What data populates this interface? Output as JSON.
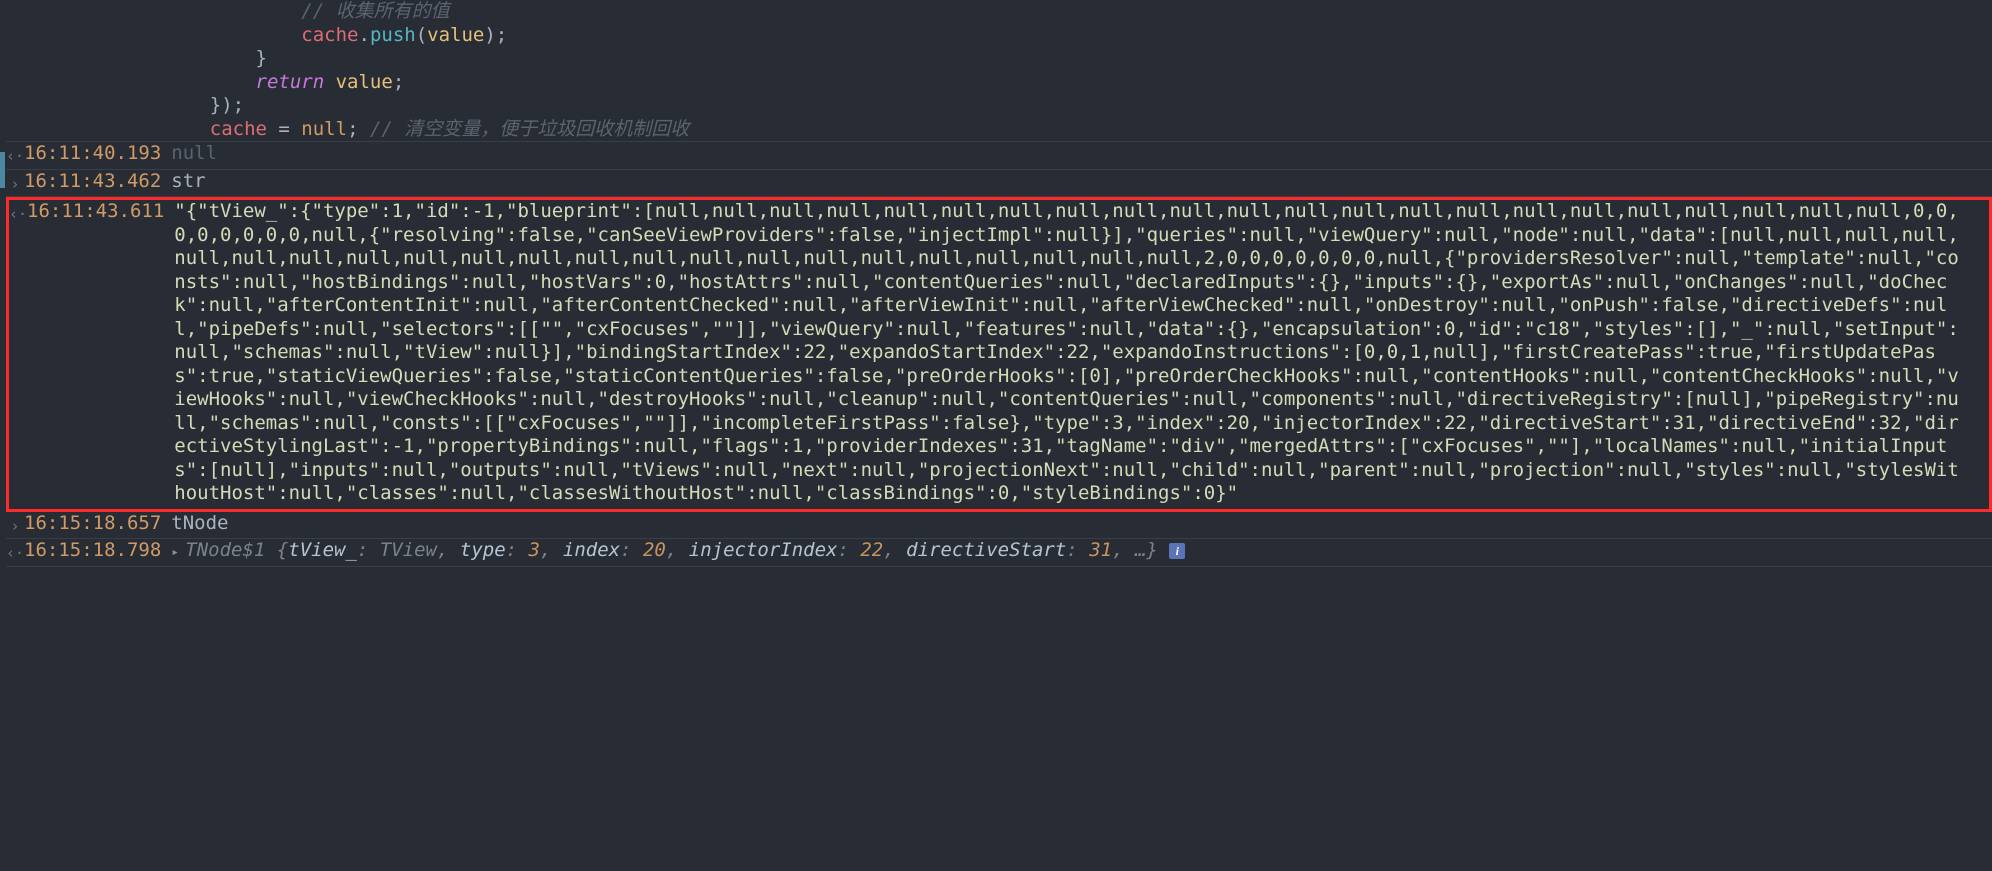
{
  "code": {
    "comment_collect": "// 收集所有的值",
    "push_line": {
      "obj": "cache",
      "fn": "push",
      "arg": "value"
    },
    "return_line": {
      "kw": "return",
      "val": "value"
    },
    "assign_line": {
      "obj": "cache",
      "val": "null",
      "comment": "// 清空变量，便于垃圾回收机制回收"
    }
  },
  "rows": [
    {
      "icon": "‹·",
      "ts": "16:11:40.193",
      "kind": "undef",
      "text": "null"
    },
    {
      "icon": "›",
      "ts": "16:11:43.462",
      "kind": "input",
      "text": "str"
    },
    {
      "icon": "‹·",
      "ts": "16:11:43.611",
      "kind": "bigstr",
      "red": true,
      "text": "\"{\"tView_\":{\"type\":1,\"id\":-1,\"blueprint\":[null,null,null,null,null,null,null,null,null,null,null,null,null,null,null,null,null,null,null,null,null,null,0,0,0,0,0,0,0,0,null,{\"resolving\":false,\"canSeeViewProviders\":false,\"injectImpl\":null}],\"queries\":null,\"viewQuery\":null,\"node\":null,\"data\":[null,null,null,null,null,null,null,null,null,null,null,null,null,null,null,null,null,null,null,null,null,null,2,0,0,0,0,0,0,0,null,{\"providersResolver\":null,\"template\":null,\"consts\":null,\"hostBindings\":null,\"hostVars\":0,\"hostAttrs\":null,\"contentQueries\":null,\"declaredInputs\":{},\"inputs\":{},\"exportAs\":null,\"onChanges\":null,\"doCheck\":null,\"afterContentInit\":null,\"afterContentChecked\":null,\"afterViewInit\":null,\"afterViewChecked\":null,\"onDestroy\":null,\"onPush\":false,\"directiveDefs\":null,\"pipeDefs\":null,\"selectors\":[[\"\",\"cxFocuses\",\"\"]],\"viewQuery\":null,\"features\":null,\"data\":{},\"encapsulation\":0,\"id\":\"c18\",\"styles\":[],\"_\":null,\"setInput\":null,\"schemas\":null,\"tView\":null}],\"bindingStartIndex\":22,\"expandoStartIndex\":22,\"expandoInstructions\":[0,0,1,null],\"firstCreatePass\":true,\"firstUpdatePass\":true,\"staticViewQueries\":false,\"staticContentQueries\":false,\"preOrderHooks\":[0],\"preOrderCheckHooks\":null,\"contentHooks\":null,\"contentCheckHooks\":null,\"viewHooks\":null,\"viewCheckHooks\":null,\"destroyHooks\":null,\"cleanup\":null,\"contentQueries\":null,\"components\":null,\"directiveRegistry\":[null],\"pipeRegistry\":null,\"schemas\":null,\"consts\":[[\"cxFocuses\",\"\"]],\"incompleteFirstPass\":false},\"type\":3,\"index\":20,\"injectorIndex\":22,\"directiveStart\":31,\"directiveEnd\":32,\"directiveStylingLast\":-1,\"propertyBindings\":null,\"flags\":1,\"providerIndexes\":31,\"tagName\":\"div\",\"mergedAttrs\":[\"cxFocuses\",\"\"],\"localNames\":null,\"initialInputs\":[null],\"inputs\":null,\"outputs\":null,\"tViews\":null,\"next\":null,\"projectionNext\":null,\"child\":null,\"parent\":null,\"projection\":null,\"styles\":null,\"stylesWithoutHost\":null,\"classes\":null,\"classesWithoutHost\":null,\"classBindings\":0,\"styleBindings\":0}\""
    },
    {
      "icon": "›",
      "ts": "16:15:18.657",
      "kind": "input",
      "text": "tNode"
    },
    {
      "icon": "‹·",
      "ts": "16:15:18.798",
      "kind": "obj"
    }
  ],
  "obj_summary": {
    "type": "TNode$1",
    "fields": [
      {
        "k": "tView_",
        "v": "TView",
        "vkind": "type"
      },
      {
        "k": "type",
        "v": "3",
        "vkind": "num"
      },
      {
        "k": "index",
        "v": "20",
        "vkind": "num"
      },
      {
        "k": "injectorIndex",
        "v": "22",
        "vkind": "num"
      },
      {
        "k": "directiveStart",
        "v": "31",
        "vkind": "num"
      }
    ],
    "trail": "…"
  },
  "icons": {
    "out": "‹·",
    "in": "›",
    "chev": "▸",
    "info": "i"
  }
}
